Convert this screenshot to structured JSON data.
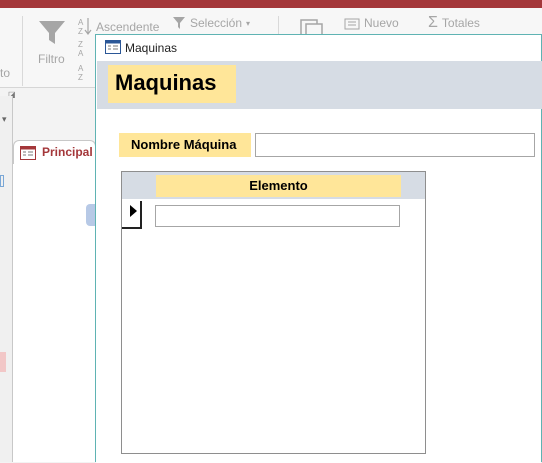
{
  "ribbon": {
    "filter_label": "Filtro",
    "ascending_label": "Ascendente",
    "selection_label": "Selección",
    "new_label": "Nuevo",
    "totals_label": "Totales",
    "cut_label": "to"
  },
  "tabs": {
    "principal_label": "Principal"
  },
  "form": {
    "window_title": "Maquinas",
    "heading": "Maquinas",
    "nombre_label": "Nombre Máquina",
    "nombre_value": "",
    "subform": {
      "column_header": "Elemento",
      "rows": [
        {
          "elemento": ""
        }
      ]
    }
  },
  "colors": {
    "accent": "#a4373a",
    "label_bg": "#ffe699",
    "header_bg": "#d6dce4",
    "window_border": "#5fb3b3"
  },
  "icons": [
    "filter-icon",
    "sort-ascending-icon",
    "selection-filter-icon",
    "new-record-icon",
    "totals-icon",
    "form-icon",
    "record-selector-arrow-icon"
  ]
}
